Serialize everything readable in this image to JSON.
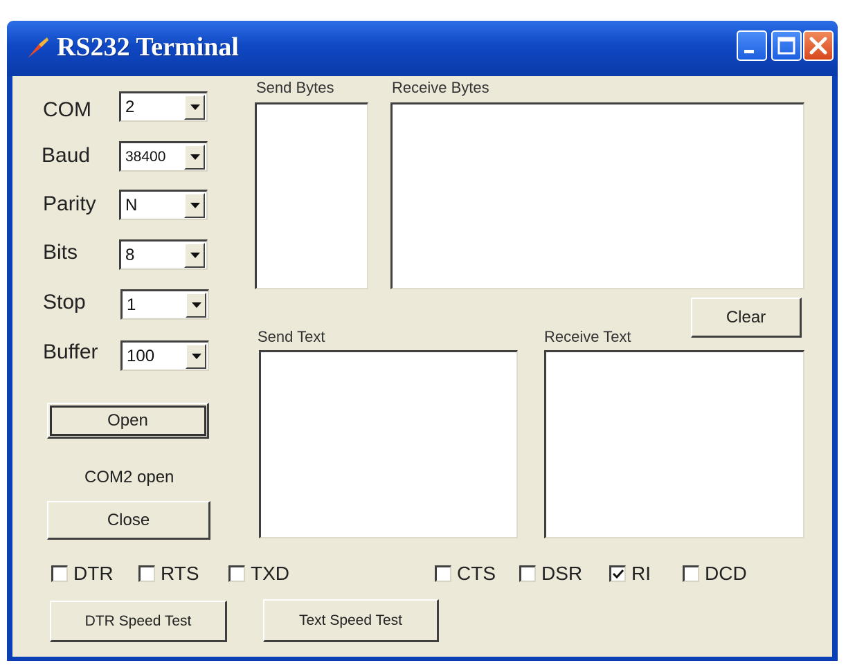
{
  "window": {
    "title": "RS232 Terminal"
  },
  "settings": {
    "com": {
      "label": "COM",
      "value": "2"
    },
    "baud": {
      "label": "Baud",
      "value": "38400"
    },
    "parity": {
      "label": "Parity",
      "value": "N"
    },
    "bits": {
      "label": "Bits",
      "value": "8"
    },
    "stop": {
      "label": "Stop",
      "value": "1"
    },
    "buffer": {
      "label": "Buffer",
      "value": "100"
    }
  },
  "buttons": {
    "open": "Open",
    "close": "Close",
    "clear": "Clear",
    "dtr_speed_test": "DTR Speed Test",
    "text_speed_test": "Text Speed Test"
  },
  "status_text": "COM2 open",
  "panels": {
    "send_bytes": "Send Bytes",
    "receive_bytes": "Receive Bytes",
    "send_text": "Send Text",
    "receive_text": "Receive Text"
  },
  "outputs": [
    {
      "label": "DTR",
      "checked": false
    },
    {
      "label": "RTS",
      "checked": false
    },
    {
      "label": "TXD",
      "checked": false
    }
  ],
  "inputs": [
    {
      "label": "CTS",
      "checked": false
    },
    {
      "label": "DSR",
      "checked": false
    },
    {
      "label": "RI",
      "checked": true
    },
    {
      "label": "DCD",
      "checked": false
    }
  ],
  "icons": {
    "app": "app-icon",
    "minimize": "minimize-icon",
    "maximize": "maximize-icon",
    "close": "close-icon",
    "dropdown": "chevron-down-icon",
    "check": "check-icon"
  },
  "colors": {
    "titlebar": "#1048c4",
    "client_bg": "#ece9d8",
    "close_button": "#d8471e"
  }
}
